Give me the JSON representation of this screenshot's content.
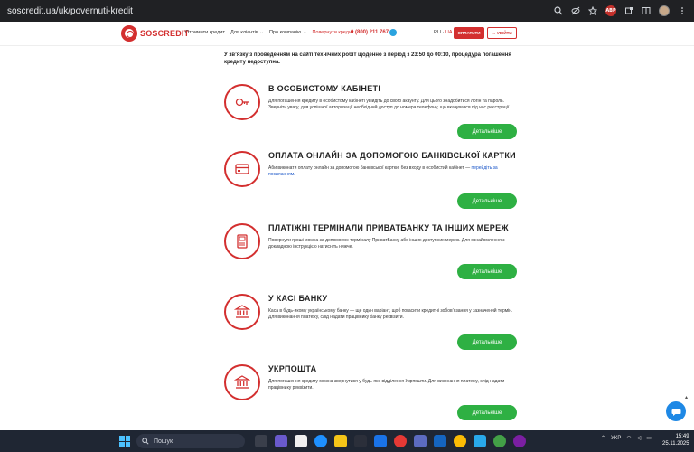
{
  "browser": {
    "url": "soscredit.ua/uk/povernuti-kredit"
  },
  "header": {
    "logo_sos": "SOS",
    "logo_credit": "CREDIT",
    "nav": [
      "Отримати кредит",
      "Для клієнтів ⌄",
      "Про компанію ⌄",
      "Повернути кредит"
    ],
    "phone": "0 (800) 211 767",
    "lang_ru": "RU",
    "lang_sep": "·",
    "lang_ua": "UA",
    "pay_label": "ОПЛАТИТИ",
    "login_label": "→ УВІЙТИ"
  },
  "notice": "У зв’язку з проведенням на сайті технічних робіт щоденно з період з 23:50 до 00:10, процедура погашення кредиту недоступна.",
  "sections": [
    {
      "title": "В ОСОБИСТОМУ КАБІНЕТІ",
      "desc": "Для погашення кредиту в особистому кабінеті увійдіть до свого акаунту. Для цього знадобиться логін та пароль. Зверніть увагу, для успішної авторизації необхідний доступ до номера телефону, що вказувався під час реєстрації.",
      "button": "Детальніше",
      "icon": "key-icon"
    },
    {
      "title": "ОПЛАТА ОНЛАЙН ЗА ДОПОМОГОЮ БАНКІВСЬКОЇ КАРТКИ",
      "desc": "Аби виконати оплату онлайн за допомогою банківської картки, без входу в особистий кабінет — ",
      "link": "перейдіть за посиланням.",
      "button": "Детальніше",
      "icon": "card-icon"
    },
    {
      "title": "ПЛАТІЖНІ ТЕРМІНАЛИ ПРИВАТБАНКУ ТА ІНШИХ МЕРЕЖ",
      "desc": "Повернути гроші можна за допомогою терміналу ПриватБанку або інших доступних мереж. Для ознайомлення з докладною інструкцією натисніть нижче.",
      "button": "Детальніше",
      "icon": "terminal-icon"
    },
    {
      "title": "У КАСІ БАНКУ",
      "desc": "Каса в будь-якому українському банку — ще один варіант, щоб погасити кредитні зобов’язання у зазначений термін. Для виконання платежу, слід надати працівнику банку реквізити.",
      "button": "Детальніше",
      "icon": "bank-icon"
    },
    {
      "title": "УКРПОШТА",
      "desc": "Для погашення кредиту можна звернутися у будь-яке відділення Укрпошти. Для виконання платежу, слід надати працівнику реквізити.",
      "button": "Детальніше",
      "icon": "post-icon"
    }
  ],
  "taskbar": {
    "search_placeholder": "Пошук",
    "lang": "УКР",
    "time": "15:49",
    "date": "25.11.2025"
  }
}
